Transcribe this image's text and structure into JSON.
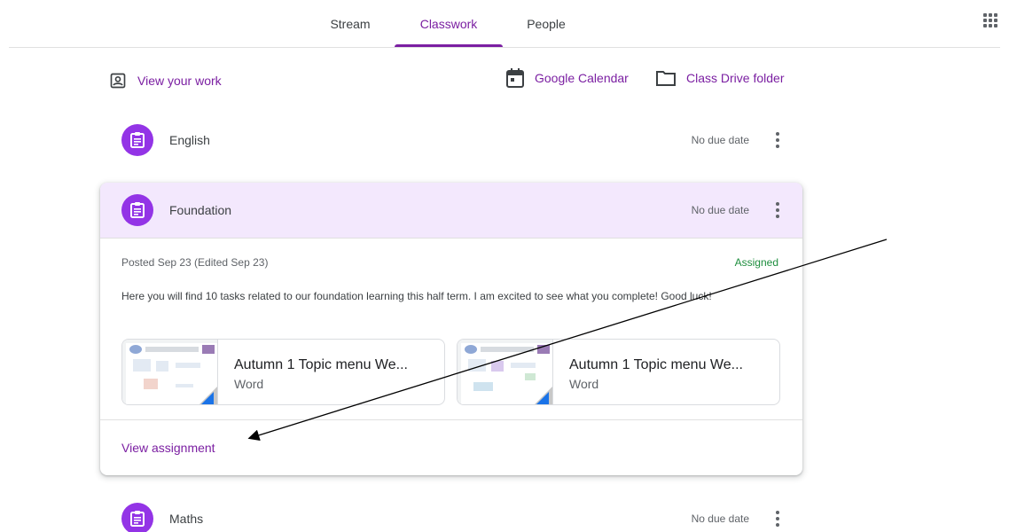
{
  "nav": {
    "tabs": [
      {
        "label": "Stream"
      },
      {
        "label": "Classwork"
      },
      {
        "label": "People"
      }
    ],
    "active_tab": "Classwork",
    "accent_color": "#7b1fa2"
  },
  "actions": {
    "view_work_label": "View your work",
    "calendar_label": "Google Calendar",
    "drive_label": "Class Drive folder"
  },
  "topics": [
    {
      "title": "English",
      "due": "No due date"
    },
    {
      "title": "Foundation",
      "due": "No due date"
    },
    {
      "title": "Maths",
      "due": "No due date"
    }
  ],
  "expanded": {
    "posted": "Posted Sep 23 (Edited Sep 23)",
    "status": "Assigned",
    "description": "Here you will find 10 tasks related to our foundation learning this half term. I am excited to see what you complete! Good luck!",
    "attachments": [
      {
        "title": "Autumn 1 Topic menu We...",
        "type": "Word"
      },
      {
        "title": "Autumn 1 Topic menu We...",
        "type": "Word"
      }
    ],
    "view_assignment_label": "View assignment"
  },
  "icons": {
    "apps": "apps-grid-icon",
    "assignment": "assignment-icon",
    "view_work": "portrait-icon",
    "calendar": "calendar-icon",
    "drive": "folder-icon",
    "more": "more-vert-icon"
  },
  "colors": {
    "topic_icon_bg": "#9334e6",
    "card_header_bg": "#f3e8fd",
    "assigned": "#1e8e3e",
    "word_badge": "#1a73e8"
  }
}
